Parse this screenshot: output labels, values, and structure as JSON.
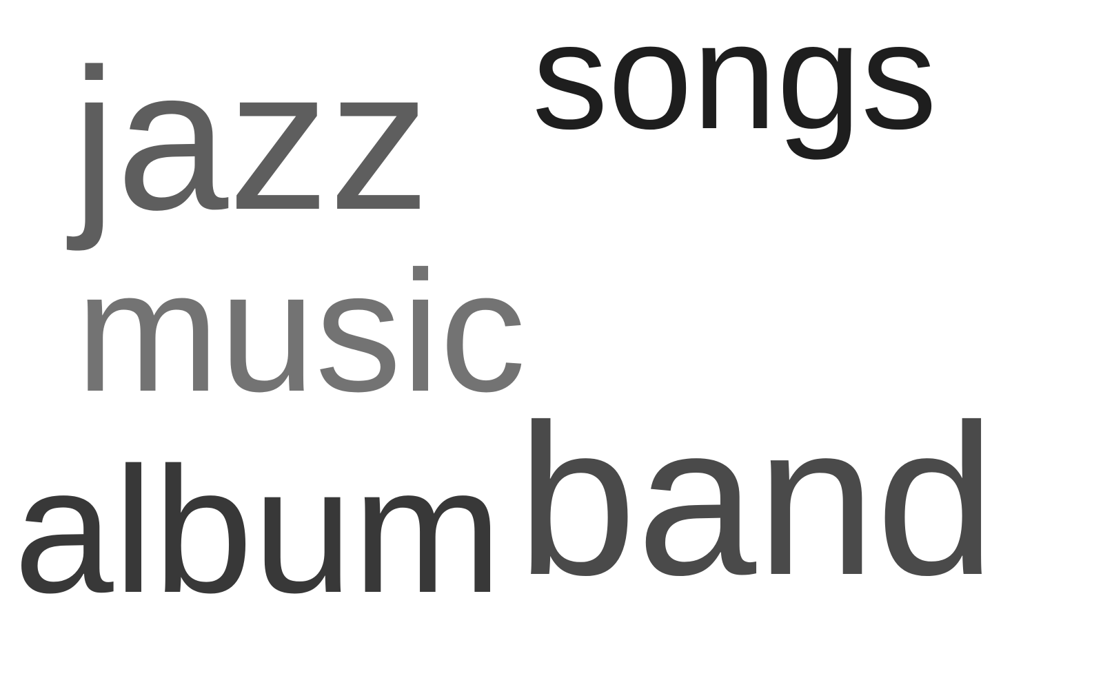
{
  "words": [
    {
      "text": "jazz",
      "color": "#5e5e5e"
    },
    {
      "text": "songs",
      "color": "#1e1e1e"
    },
    {
      "text": "music",
      "color": "#737373"
    },
    {
      "text": "album",
      "color": "#383838"
    },
    {
      "text": "band",
      "color": "#4a4a4a"
    }
  ]
}
